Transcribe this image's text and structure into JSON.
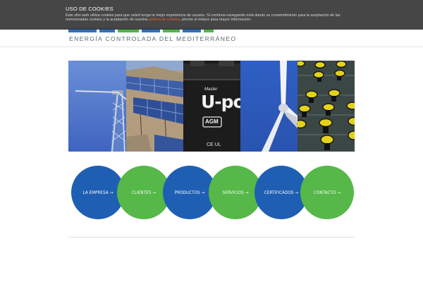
{
  "header": {
    "tagline": "ENERGÍA CONTROLADA DEL MEDITERRÁNEO"
  },
  "cookie_banner": {
    "title": "USO DE COOKIES",
    "text_before_link": "Este sitio web utiliza cookies para que usted tenga la mejor experiencia de usuario. Si continúa navegando está dando su consentimiento para la aceptación de las mencionadas cookies y la aceptación de nuestra ",
    "link_label": "política de cookies",
    "text_after_link": ", pinche el enlace para mayor información."
  },
  "hero": {
    "battery_brand": "Master",
    "battery_model": "U-po",
    "battery_type": "AGM",
    "battery_marks": "CE UL"
  },
  "menu": {
    "items": [
      {
        "label": "LA EMPRESA",
        "color": "#1f5fb3"
      },
      {
        "label": "CLIENTES",
        "color": "#55b848"
      },
      {
        "label": "PRODUCTOS",
        "color": "#1f5fb3"
      },
      {
        "label": "SERVICIOS",
        "color": "#55b848"
      },
      {
        "label": "CERTIFICADOS",
        "color": "#1f5fb3"
      },
      {
        "label": "CONTACTO",
        "color": "#55b848"
      }
    ],
    "arrow": "→"
  },
  "colors": {
    "brand_blue": "#1f5fb3",
    "brand_green": "#55b848",
    "cookie_link": "#e8602c"
  }
}
